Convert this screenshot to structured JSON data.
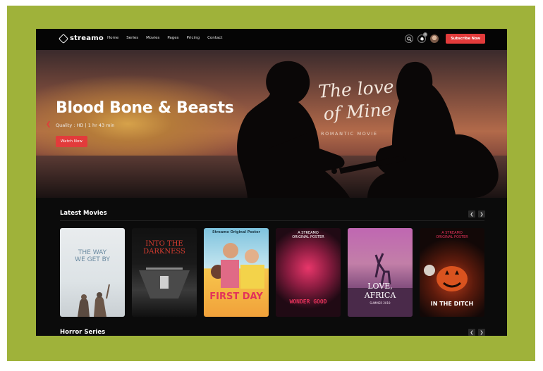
{
  "brand": {
    "name": "streamo"
  },
  "nav": [
    "Home",
    "Series",
    "Movies",
    "Pages",
    "Pricing",
    "Contact"
  ],
  "header": {
    "notification_count": "0",
    "subscribe_label": "Subscribe Now"
  },
  "hero": {
    "title": "Blood Bone & Beasts",
    "meta": "Quality : HD  |  1 hr 43 min",
    "cta": "Watch Now",
    "poster_title_line1": "The love",
    "poster_title_line2": "of Mine",
    "poster_subtitle": "ROMANTIC MOVIE"
  },
  "latest": {
    "title": "Latest Movies",
    "posters": [
      {
        "line1": "THE WAY",
        "line2": "WE GET BY"
      },
      {
        "line1": "INTO THE",
        "line2": "DARKNESS"
      },
      {
        "top": "Streamo Original Poster",
        "bottom": "FIRST DAY"
      },
      {
        "top": "A STREAMO ORIGINAL POSTER",
        "bottom": "WONDER GOOD"
      },
      {
        "line1": "LOVE,",
        "line2": "AFRICA",
        "sub": "SUMMER 2019"
      },
      {
        "top": "A STREAMO ORIGINAL POSTER",
        "bottom": "IN THE DITCH"
      }
    ]
  },
  "horror": {
    "title": "Horror Series"
  },
  "colors": {
    "accent": "#e23b3b",
    "frame": "#9fb23a",
    "background": "#0b0b0b"
  }
}
